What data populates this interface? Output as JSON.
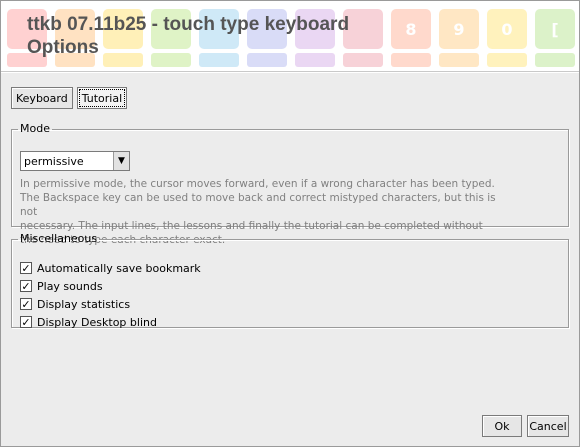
{
  "window": {
    "title_line1": "ttkb 07.11b25 - touch type keyboard",
    "title_line2": "Options"
  },
  "backdrop": {
    "top_keys": [
      {
        "label": "",
        "color": "#ffd1d1"
      },
      {
        "label": "",
        "color": "#ffe2c2"
      },
      {
        "label": "",
        "color": "#fff0b8"
      },
      {
        "label": "",
        "color": "#dff3c6"
      },
      {
        "label": "",
        "color": "#cfe9f7"
      },
      {
        "label": "",
        "color": "#d9dcf7"
      },
      {
        "label": "",
        "color": "#ead7f3"
      },
      {
        "label": "",
        "color": "#f7d2d8"
      },
      {
        "label": "8",
        "color": "#ffd9cc"
      },
      {
        "label": "9",
        "color": "#ffe7c4"
      },
      {
        "label": "0",
        "color": "#fff2bd"
      },
      {
        "label": "[",
        "color": "#dcf2c9"
      },
      {
        "label": "]",
        "color": "#cfe9f7"
      }
    ],
    "bottom_colors": [
      "#ffd1d1",
      "#ffe2c2",
      "#fff0b8",
      "#dff3c6",
      "#cfe9f7",
      "#d9dcf7",
      "#ead7f3",
      "#f7d2d8",
      "#ffd9cc",
      "#ffe7c4",
      "#fff2bd",
      "#dcf2c9",
      "#cfe9f7"
    ]
  },
  "tabs": [
    {
      "label": "Keyboard",
      "active": false
    },
    {
      "label": "Tutorial",
      "active": true
    }
  ],
  "mode": {
    "legend": "Mode",
    "selected": "permissive",
    "description_lines": [
      "In permissive mode, the cursor moves forward, even if a wrong character has been typed.",
      "The Backspace key can be used to move back and correct mistyped characters, but this is not",
      "necessary. The input lines, the lessons and finally the tutorial can be completed without",
      "the need to type each character exact."
    ]
  },
  "misc": {
    "legend": "Miscellaneous",
    "options": [
      {
        "label": "Automatically save bookmark",
        "checked": true
      },
      {
        "label": "Play sounds",
        "checked": true
      },
      {
        "label": "Display statistics",
        "checked": true
      },
      {
        "label": "Display Desktop blind",
        "checked": true
      }
    ]
  },
  "buttons": {
    "ok": "Ok",
    "cancel": "Cancel"
  }
}
